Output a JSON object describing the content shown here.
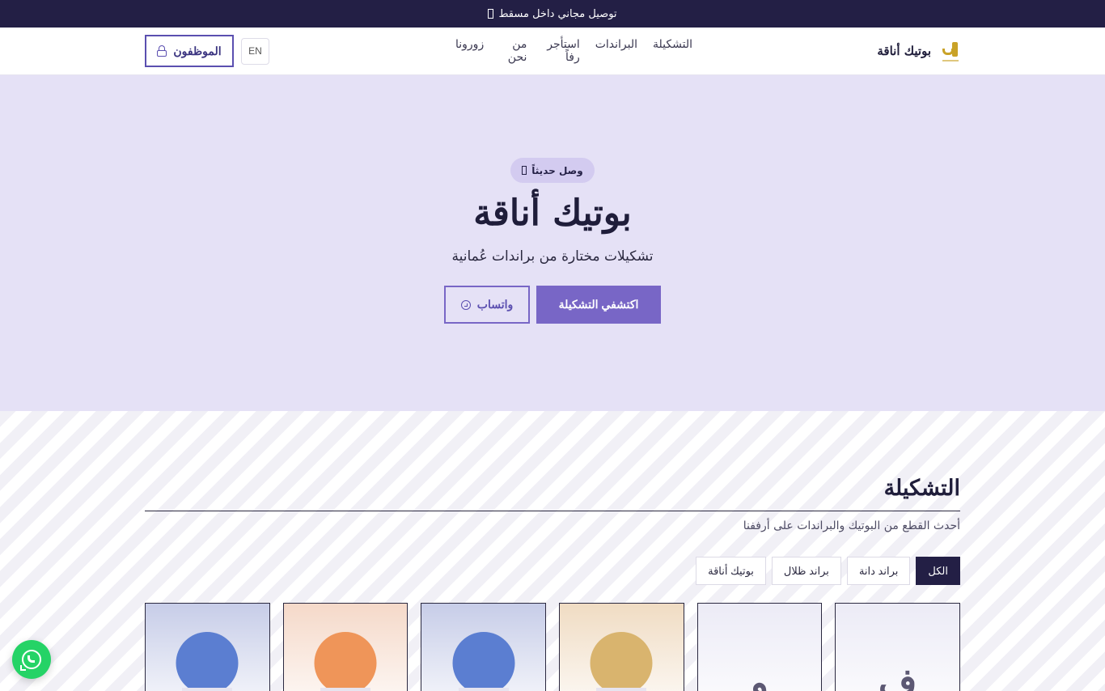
{
  "announcement": {
    "text": "توصيل مجاني داخل مسقط"
  },
  "header": {
    "brand_name": "بوتيك أناقة",
    "logo_icon": "boutique-logo-icon",
    "nav": [
      {
        "label": "التشكيلة"
      },
      {
        "label": "البراندات"
      },
      {
        "label": "استأجر رفاً"
      },
      {
        "label": "من نحن"
      },
      {
        "label": "زورونا"
      }
    ],
    "lang_label": "EN",
    "staff_label": "الموظفون",
    "staff_icon": "lock-icon"
  },
  "hero": {
    "badge": "وصل حديثاً",
    "title": "بوتيك أناقة",
    "subtitle": "تشكيلات مختارة من براندات عُمانية",
    "primary_cta": "اكتشفي التشكيلة",
    "secondary_cta": "واتساب",
    "secondary_icon": "whatsapp-icon"
  },
  "collection": {
    "title": "التشكيلة",
    "subtitle": "أحدث القطع من البوتيك والبراندات على أرففنا",
    "filters": [
      {
        "label": "الكل",
        "active": true
      },
      {
        "label": "براند دانة",
        "active": false
      },
      {
        "label": "براند ظلال",
        "active": false
      },
      {
        "label": "بوتيك أناقة",
        "active": false
      }
    ],
    "products": [
      {
        "bg": "#ecebf6",
        "accent": "",
        "glyph": "ف"
      },
      {
        "bg": "#ecebf6",
        "accent": "",
        "glyph": "و"
      },
      {
        "bg": "#f0dcc3",
        "accent": "#d9b46e",
        "glyph": ""
      },
      {
        "bg": "#c7cde8",
        "accent": "#5b7ed1",
        "glyph": ""
      },
      {
        "bg": "#f5d9c9",
        "accent": "#ef9559",
        "glyph": ""
      },
      {
        "bg": "#c7cde8",
        "accent": "#5b7ed1",
        "glyph": ""
      }
    ]
  },
  "floating": {
    "whatsapp_icon": "whatsapp-icon",
    "color": "#25d366"
  },
  "colors": {
    "topbar": "#231f45",
    "primary": "#7866c6",
    "hero_bg": "#e5e1f6",
    "badge_bg": "#d3cbf0",
    "gold": "#c9a227"
  }
}
